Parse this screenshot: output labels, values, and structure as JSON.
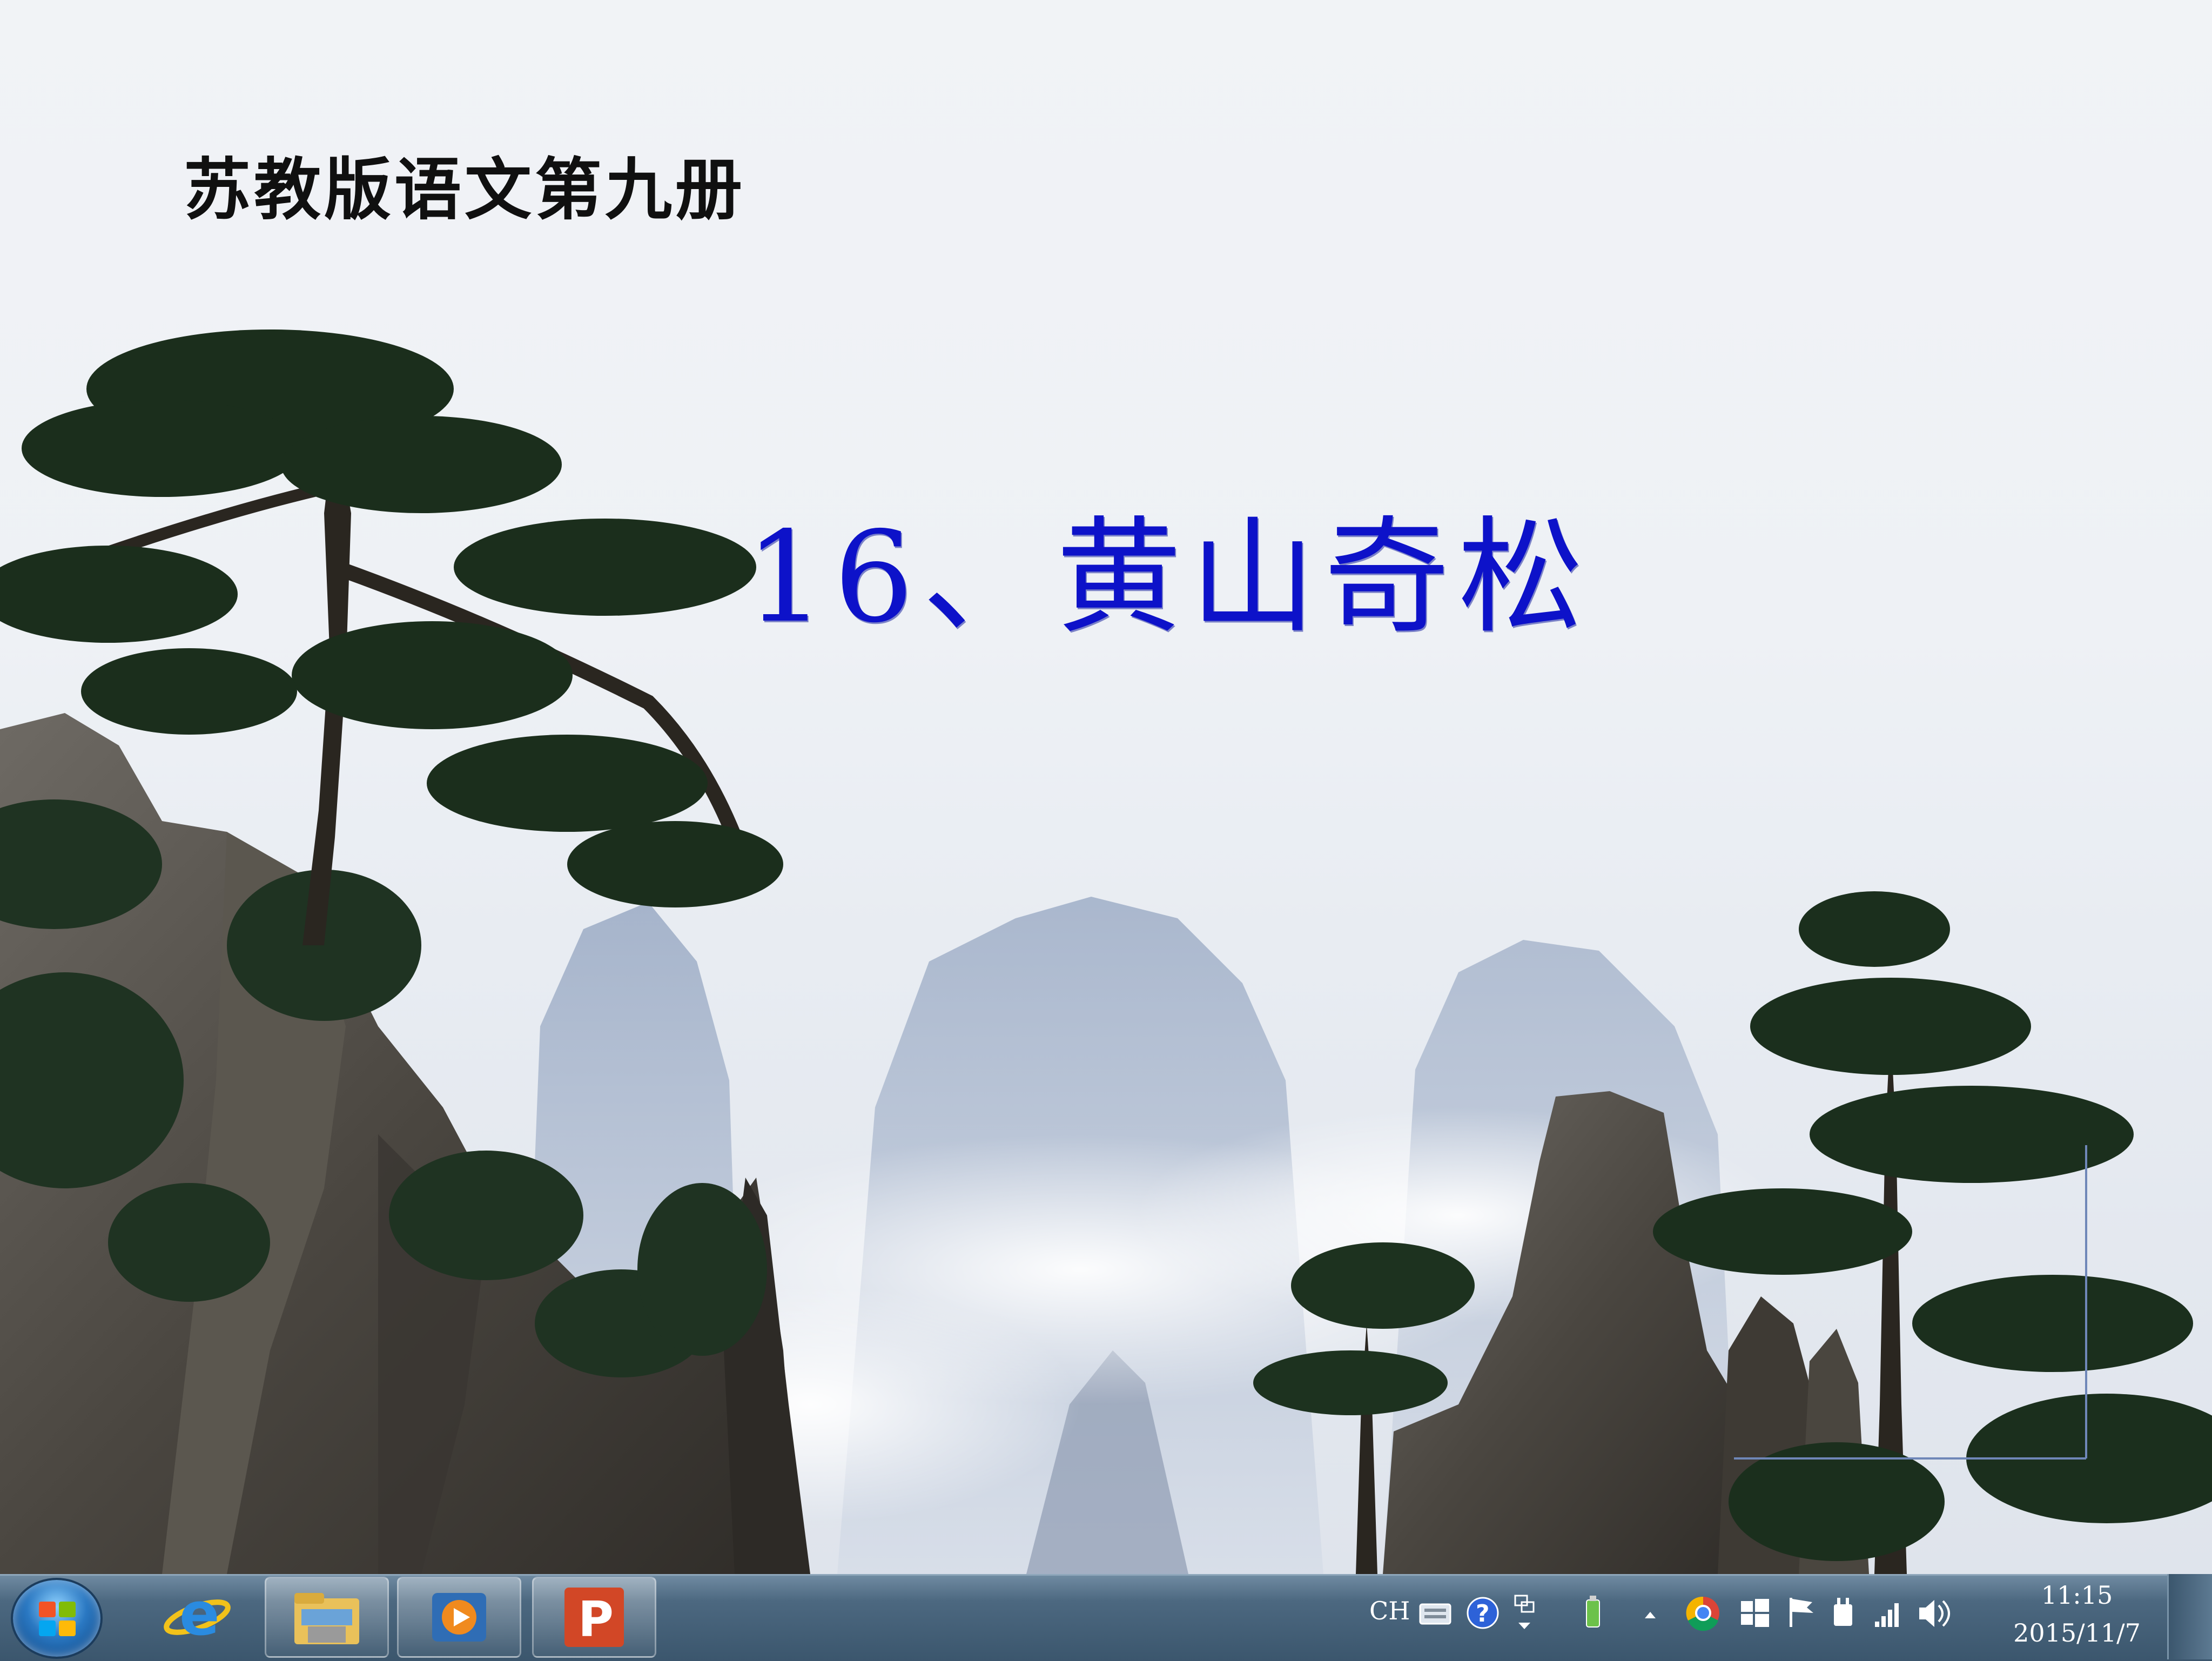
{
  "slide": {
    "subtitle": "苏教版语文第九册",
    "title": "16、黄山奇松"
  },
  "taskbar": {
    "start_icon": "windows-start-orb-icon",
    "apps": [
      {
        "name": "internet-explorer-icon"
      },
      {
        "name": "file-explorer-icon"
      },
      {
        "name": "media-player-icon"
      },
      {
        "name": "powerpoint-icon"
      }
    ],
    "tray": {
      "input_language": "CH",
      "icons": [
        "keyboard-icon",
        "help-icon",
        "language-bar-icon",
        "usb-device-icon",
        "show-hidden-icons-arrow",
        "chrome-icon",
        "windows-flag-icon",
        "action-center-flag-icon",
        "power-icon",
        "network-signal-icon",
        "volume-icon"
      ]
    },
    "clock": {
      "time": "11:15",
      "date": "2015/11/7"
    }
  },
  "colors": {
    "title": "#0d12c9",
    "subtitle": "#101010",
    "taskbar": "#3b566d"
  }
}
